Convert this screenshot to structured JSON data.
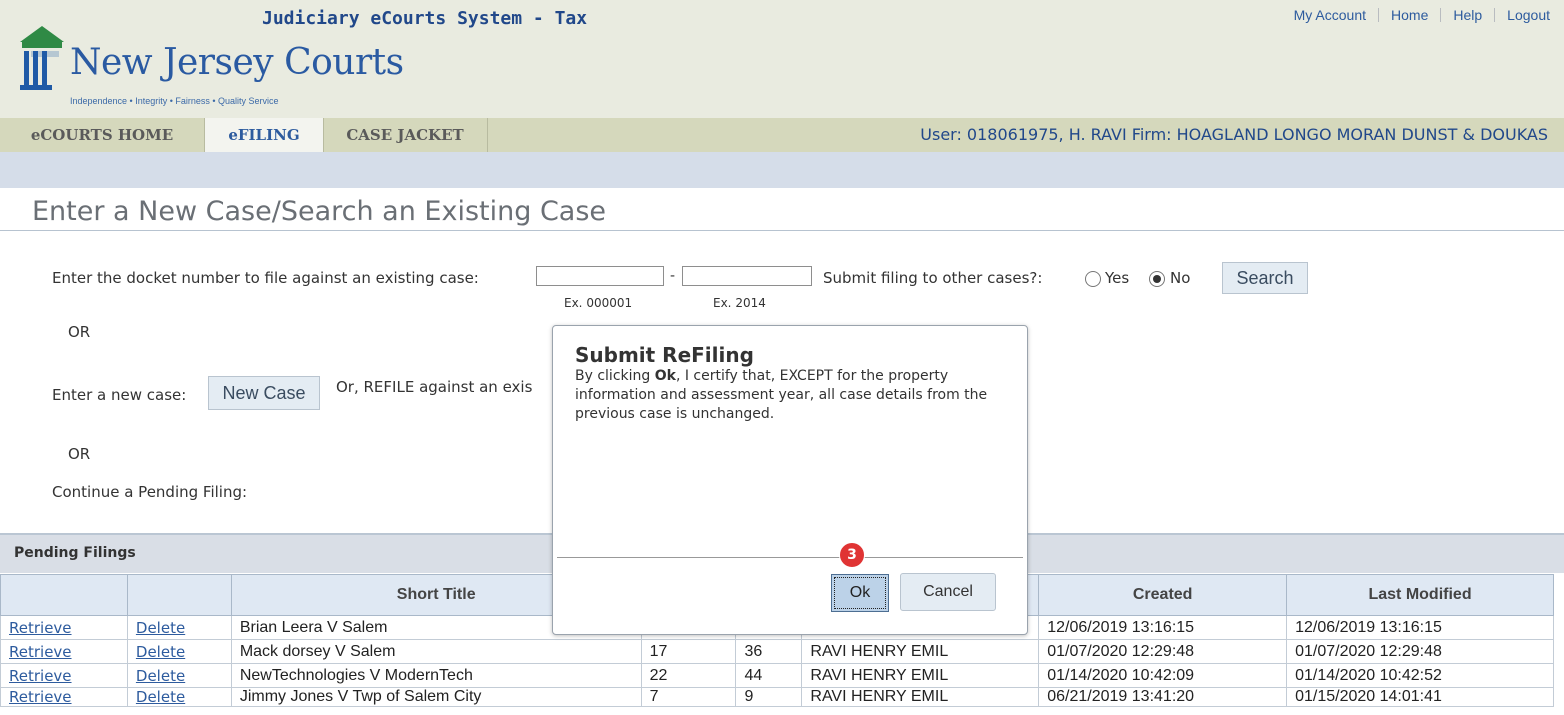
{
  "header": {
    "system_title": "Judiciary eCourts System - Tax",
    "logo_text": "New Jersey Courts",
    "logo_tagline": "Independence • Integrity • Fairness • Quality Service",
    "links": [
      "My Account",
      "Home",
      "Help",
      "Logout"
    ],
    "user_line": "User: 018061975, H. RAVI  Firm: HOAGLAND LONGO MORAN DUNST & DOUKAS"
  },
  "tabs": [
    "eCOURTS HOME",
    "eFILING",
    "CASE JACKET"
  ],
  "active_tab": "eFILING",
  "page_title": "Enter a New Case/Search an Existing Case",
  "form": {
    "docket_label": "Enter the docket number to file against an existing case:",
    "docket_value_1": "",
    "docket_dash": "-",
    "docket_value_2": "",
    "example_1": "Ex. 000001",
    "example_2": "Ex. 2014",
    "other_cases_label": "Submit filing to other cases?:",
    "radio_yes": "Yes",
    "radio_no": "No",
    "selected_radio": "No",
    "search_button": "Search",
    "or_1": "OR",
    "new_case_label": "Enter a new case:",
    "new_case_button": "New Case",
    "refile_label": "Or, REFILE against an exis",
    "or_2": "OR",
    "pending_label": "Continue a Pending Filing:"
  },
  "pending": {
    "title": "Pending Filings",
    "columns": [
      "",
      "",
      "Short Title",
      "",
      "",
      "",
      "Created",
      "Last Modified"
    ],
    "rows": [
      {
        "retrieve": "Retrieve",
        "delete": "Delete",
        "title": "Brian Leera V Salem",
        "c4": "",
        "c5": "",
        "c6": "",
        "created": "12/06/2019 13:16:15",
        "modified": "12/06/2019 13:16:15"
      },
      {
        "retrieve": "Retrieve",
        "delete": "Delete",
        "title": "Mack dorsey V Salem",
        "c4": "17",
        "c5": "36",
        "c6": "RAVI HENRY EMIL",
        "created": "01/07/2020 12:29:48",
        "modified": "01/07/2020 12:29:48"
      },
      {
        "retrieve": "Retrieve",
        "delete": "Delete",
        "title": "NewTechnologies V ModernTech",
        "c4": "22",
        "c5": "44",
        "c6": "RAVI HENRY EMIL",
        "created": "01/14/2020 10:42:09",
        "modified": "01/14/2020 10:42:52"
      },
      {
        "retrieve": "Retrieve",
        "delete": "Delete",
        "title": "Jimmy Jones V Twp of Salem City",
        "c4": "7",
        "c5": "9",
        "c6": "RAVI HENRY EMIL",
        "created": "06/21/2019 13:41:20",
        "modified": "01/15/2020 14:01:41"
      }
    ]
  },
  "dialog": {
    "title": "Submit ReFiling",
    "body_prefix": "By clicking ",
    "body_bold": "Ok",
    "body_suffix": ", I certify that, EXCEPT for the property information and assessment year, all case details from the previous case is unchanged.",
    "step_badge": "3",
    "ok_button": "Ok",
    "cancel_button": "Cancel"
  },
  "colors": {
    "header_bg": "#e9ebe0",
    "tab_bar": "#d5d8bc",
    "link_blue": "#2d5b9e",
    "badge_red": "#e03434"
  }
}
